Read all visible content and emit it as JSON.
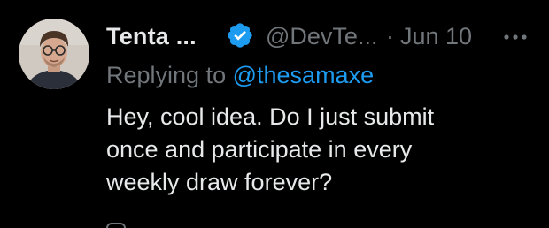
{
  "tweet": {
    "author_name": "Tenta ...",
    "handle": "@DevTe...",
    "separator": "·",
    "date": "Jun 10",
    "reply_prefix": "Replying to",
    "reply_mention": "@thesamaxe",
    "body_lines": [
      "Hey, cool idea. Do I just submit",
      "once and participate in every",
      "weekly draw forever?"
    ]
  },
  "icons": {
    "verified": "verified-badge-icon",
    "more": "more-options-icon"
  },
  "colors": {
    "background": "#000000",
    "primary_text": "#e7e9ea",
    "secondary_text": "#71767b",
    "accent": "#1d9bf0"
  }
}
